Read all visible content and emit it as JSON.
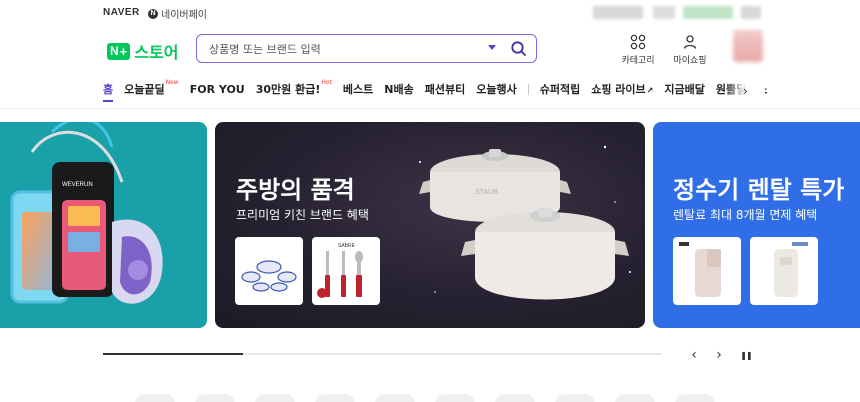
{
  "topbar": {
    "naver_label": "NAVER",
    "npay_mark": "N",
    "npay_label": "네이버페이"
  },
  "header": {
    "logo_badge_n": "N",
    "logo_badge_plus": "+",
    "logo_text": "스토어",
    "search_placeholder": "상품명 또는 브랜드 입력",
    "category_label": "카테고리",
    "myshopping_label": "마이쇼핑"
  },
  "nav": {
    "items": [
      {
        "label": "홈",
        "badge": ""
      },
      {
        "label": "오늘끝딜",
        "badge": "New"
      },
      {
        "label": "FOR YOU",
        "badge": ""
      },
      {
        "label": "30만원 환급!",
        "badge": "Hot"
      },
      {
        "label": "베스트",
        "badge": ""
      },
      {
        "label": "N배송",
        "badge": ""
      },
      {
        "label": "패션뷰티",
        "badge": ""
      },
      {
        "label": "오늘행사",
        "badge": ""
      },
      {
        "label": "슈퍼적립",
        "badge": ""
      },
      {
        "label": "쇼핑 라이브",
        "badge": ""
      },
      {
        "label": "지금배달",
        "badge": ""
      },
      {
        "label": "원쁠딜",
        "badge": ""
      },
      {
        "label": "쇼",
        "badge": ""
      }
    ],
    "next_glyph": "›"
  },
  "banners": {
    "left": {
      "brand": "WEVERUN"
    },
    "center": {
      "title": "주방의 품격",
      "subtitle": "프리미엄 키친 브랜드 혜택",
      "pot_brand": "STAUB",
      "thumb_brand": "SABRE"
    },
    "right": {
      "title": "정수기 렌탈 특가",
      "subtitle": "렌탈료 최대 8개월 면제 혜택"
    }
  },
  "carousel": {
    "progress": 0.25,
    "prev_glyph": "‹",
    "next_glyph": "›",
    "pause_glyph": "❚❚"
  },
  "colors": {
    "brand_green": "#03c75a",
    "accent_purple": "#5a3fd4",
    "teal_banner": "#19a0a8",
    "blue_banner": "#2f6ee6"
  }
}
